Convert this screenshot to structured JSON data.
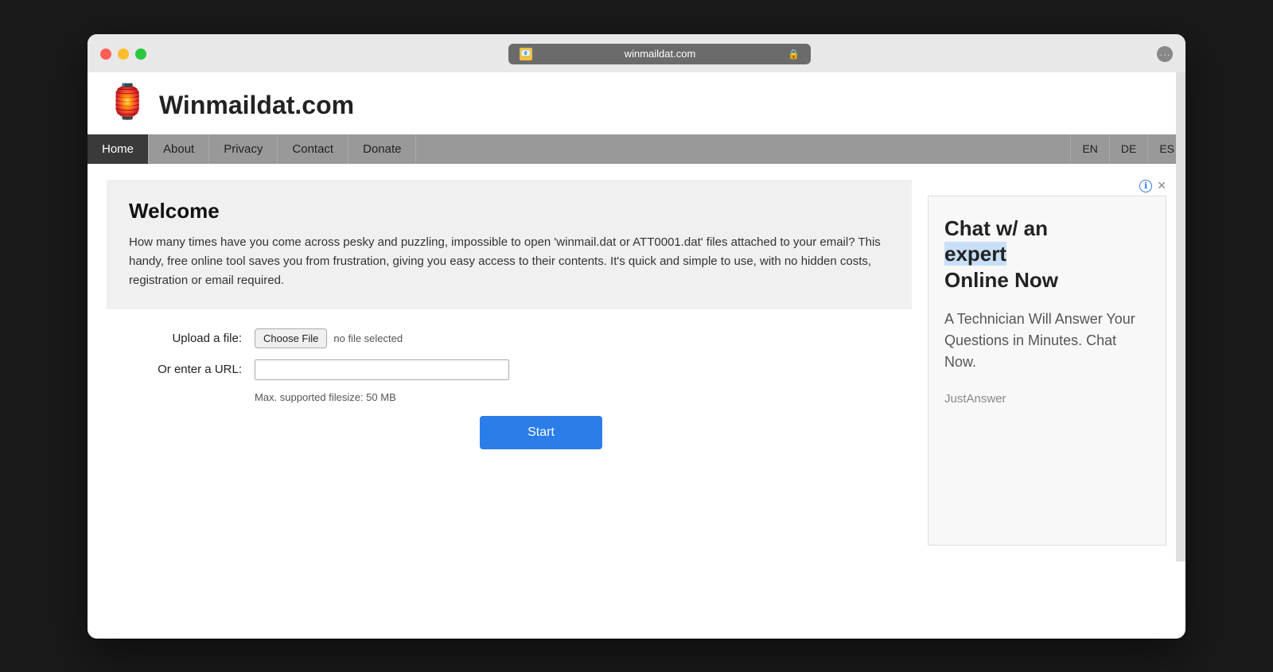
{
  "browser": {
    "address": "winmaildat.com",
    "lock_symbol": "🔒",
    "favicon": "📧"
  },
  "traffic_lights": {
    "red": "red",
    "yellow": "yellow",
    "green": "green"
  },
  "site": {
    "title": "Winmaildat.com",
    "logo_emoji": "🏮"
  },
  "nav": {
    "items": [
      {
        "label": "Home",
        "active": true
      },
      {
        "label": "About",
        "active": false
      },
      {
        "label": "Privacy",
        "active": false
      },
      {
        "label": "Contact",
        "active": false
      },
      {
        "label": "Donate",
        "active": false
      }
    ],
    "languages": [
      {
        "code": "EN"
      },
      {
        "code": "DE"
      },
      {
        "code": "ES"
      }
    ]
  },
  "welcome": {
    "title": "Welcome",
    "body": "How many times have you come across pesky and puzzling, impossible to open 'winmail.dat or ATT0001.dat' files attached to your email? This handy, free online tool saves you from frustration, giving you easy access to their contents. It's quick and simple to use, with no hidden costs, registration or email required."
  },
  "form": {
    "upload_label": "Upload a file:",
    "choose_file_btn": "Choose File",
    "no_file_text": "no file selected",
    "url_label": "Or enter a URL:",
    "url_placeholder": "",
    "filesize_note": "Max. supported filesize: 50 MB",
    "start_btn": "Start"
  },
  "ad": {
    "headline_part1": "Chat w/ an",
    "headline_highlight": "expert",
    "headline_part2": "Online Now",
    "subtext": "A Technician Will Answer Your Questions in Minutes. Chat Now.",
    "brand": "JustAnswer"
  }
}
